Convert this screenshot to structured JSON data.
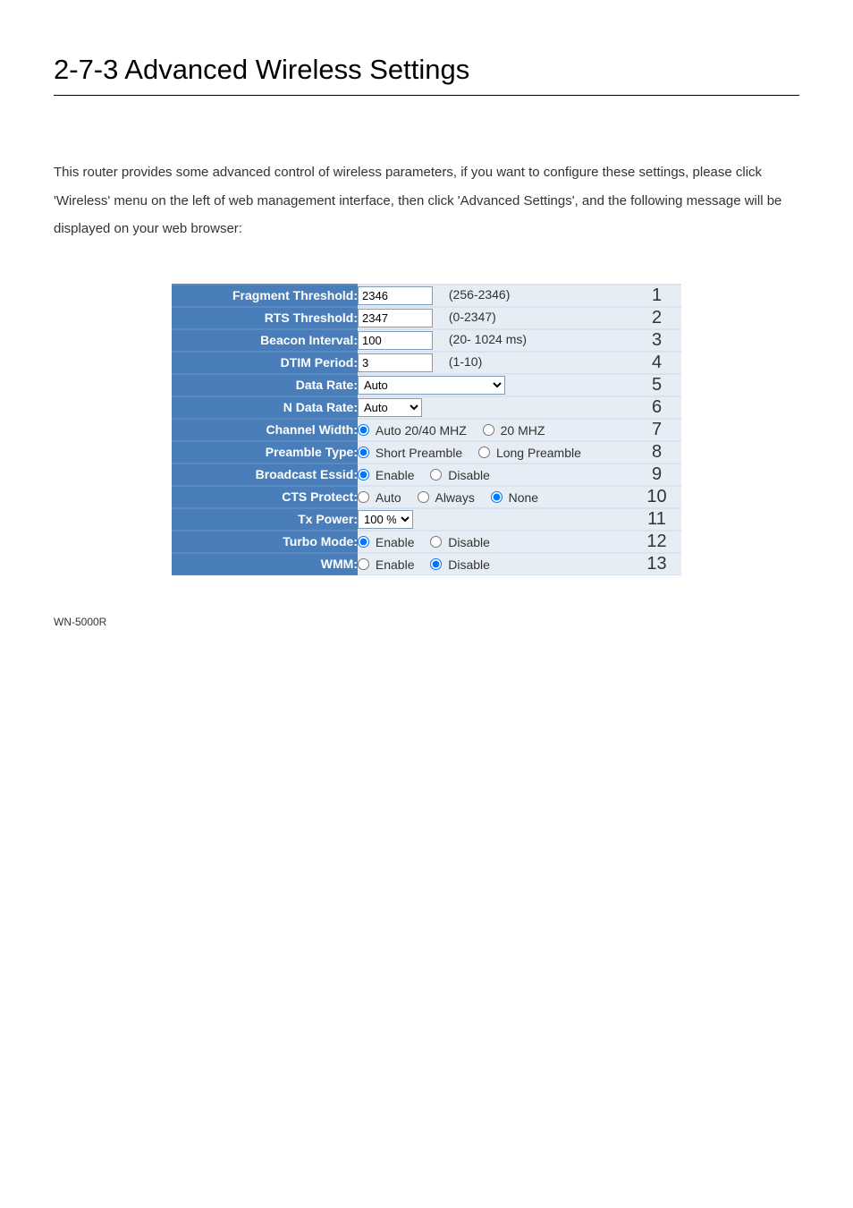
{
  "section_title": "2-7-3 Advanced Wireless Settings",
  "intro": "This router provides some advanced control of wireless parameters, if you want to configure these settings, please click 'Wireless' menu on the left of web management interface, then click 'Advanced Settings', and the following message will be displayed on your web browser:",
  "rows": [
    {
      "label": "Fragment Threshold:",
      "num": "1"
    },
    {
      "label": "RTS Threshold:",
      "num": "2"
    },
    {
      "label": "Beacon Interval:",
      "num": "3"
    },
    {
      "label": "DTIM Period:",
      "num": "4"
    },
    {
      "label": "Data Rate:",
      "num": "5"
    },
    {
      "label": "N Data Rate:",
      "num": "6"
    },
    {
      "label": "Channel Width:",
      "num": "7"
    },
    {
      "label": "Preamble Type:",
      "num": "8"
    },
    {
      "label": "Broadcast Essid:",
      "num": "9"
    },
    {
      "label": "CTS Protect:",
      "num": "10"
    },
    {
      "label": "Tx Power:",
      "num": "11"
    },
    {
      "label": "Turbo Mode:",
      "num": "12"
    },
    {
      "label": "WMM:",
      "num": "13"
    }
  ],
  "fields": {
    "fragment_threshold": {
      "value": "2346",
      "hint": "(256-2346)"
    },
    "rts_threshold": {
      "value": "2347",
      "hint": "(0-2347)"
    },
    "beacon_interval": {
      "value": "100",
      "hint": "(20- 1024 ms)"
    },
    "dtim_period": {
      "value": "3",
      "hint": "(1-10)"
    },
    "data_rate": {
      "selected": "Auto"
    },
    "n_data_rate": {
      "selected": "Auto"
    },
    "channel_width": {
      "opt1": "Auto 20/40 MHZ",
      "opt2": "20 MHZ"
    },
    "preamble_type": {
      "opt1": "Short Preamble",
      "opt2": "Long Preamble"
    },
    "broadcast_essid": {
      "opt1": "Enable",
      "opt2": "Disable"
    },
    "cts_protect": {
      "opt1": "Auto",
      "opt2": "Always",
      "opt3": "None"
    },
    "tx_power": {
      "selected": "100 %"
    },
    "turbo_mode": {
      "opt1": "Enable",
      "opt2": "Disable"
    },
    "wmm": {
      "opt1": "Enable",
      "opt2": "Disable"
    }
  },
  "footer": "WN-5000R"
}
